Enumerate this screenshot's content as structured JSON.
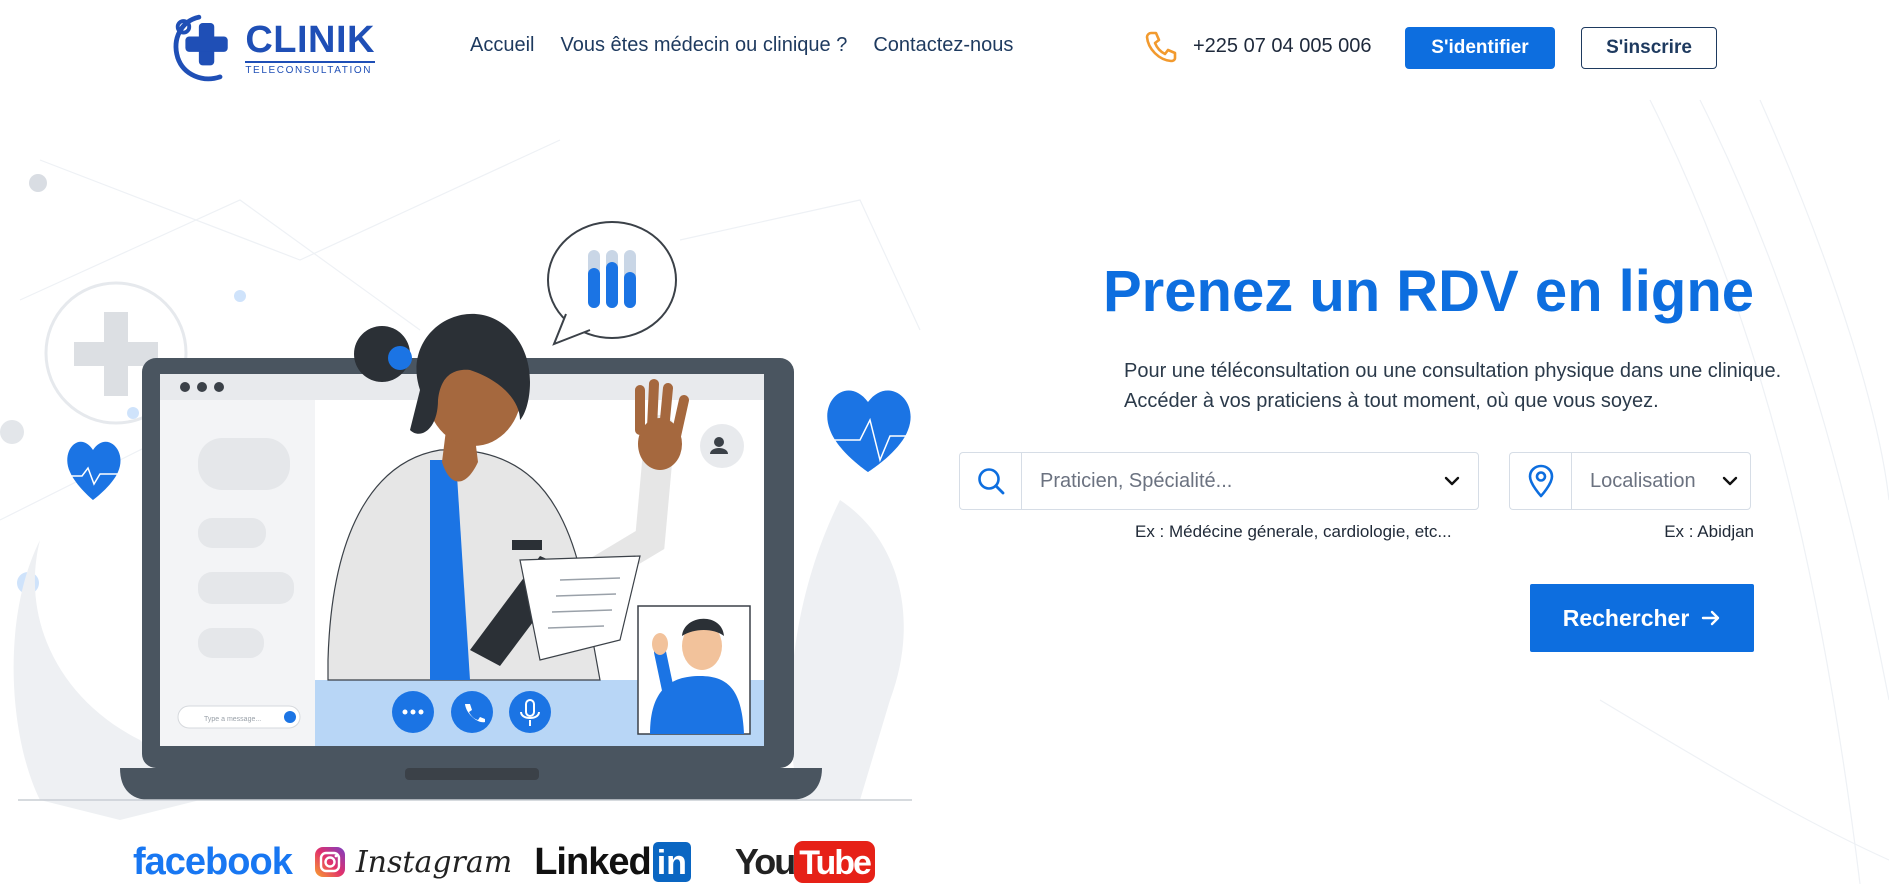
{
  "brand": {
    "name": "CLINIK",
    "tagline": "TELECONSULTATION",
    "primary_color": "#0d6edf",
    "logo_color": "#1f4fb6"
  },
  "nav": {
    "items": [
      {
        "label": "Accueil"
      },
      {
        "label": "Vous êtes médecin ou clinique ?"
      },
      {
        "label": "Contactez-nous"
      }
    ]
  },
  "header": {
    "phone": "+225 07 04 005 006",
    "login_label": "S'identifier",
    "register_label": "S'inscrire"
  },
  "hero": {
    "title": "Prenez un RDV en ligne",
    "desc_line1": "Pour une téléconsultation ou une consultation physique dans une clinique.",
    "desc_line2": "Accéder à vos praticiens à tout moment, où que vous soyez."
  },
  "search": {
    "specialty_placeholder": "Praticien, Spécialité...",
    "specialty_hint": "Ex : Médécine génerale, cardiologie, etc...",
    "location_placeholder": "Localisation",
    "location_hint": "Ex : Abidjan",
    "submit_label": "Rechercher"
  },
  "illustration": {
    "chat_input_placeholder": "Type a message..."
  },
  "social": {
    "facebook": "facebook",
    "instagram": "Instagram",
    "linkedin_text": "Linked",
    "linkedin_box": "in",
    "youtube_you": "You",
    "youtube_tube": "Tube"
  }
}
